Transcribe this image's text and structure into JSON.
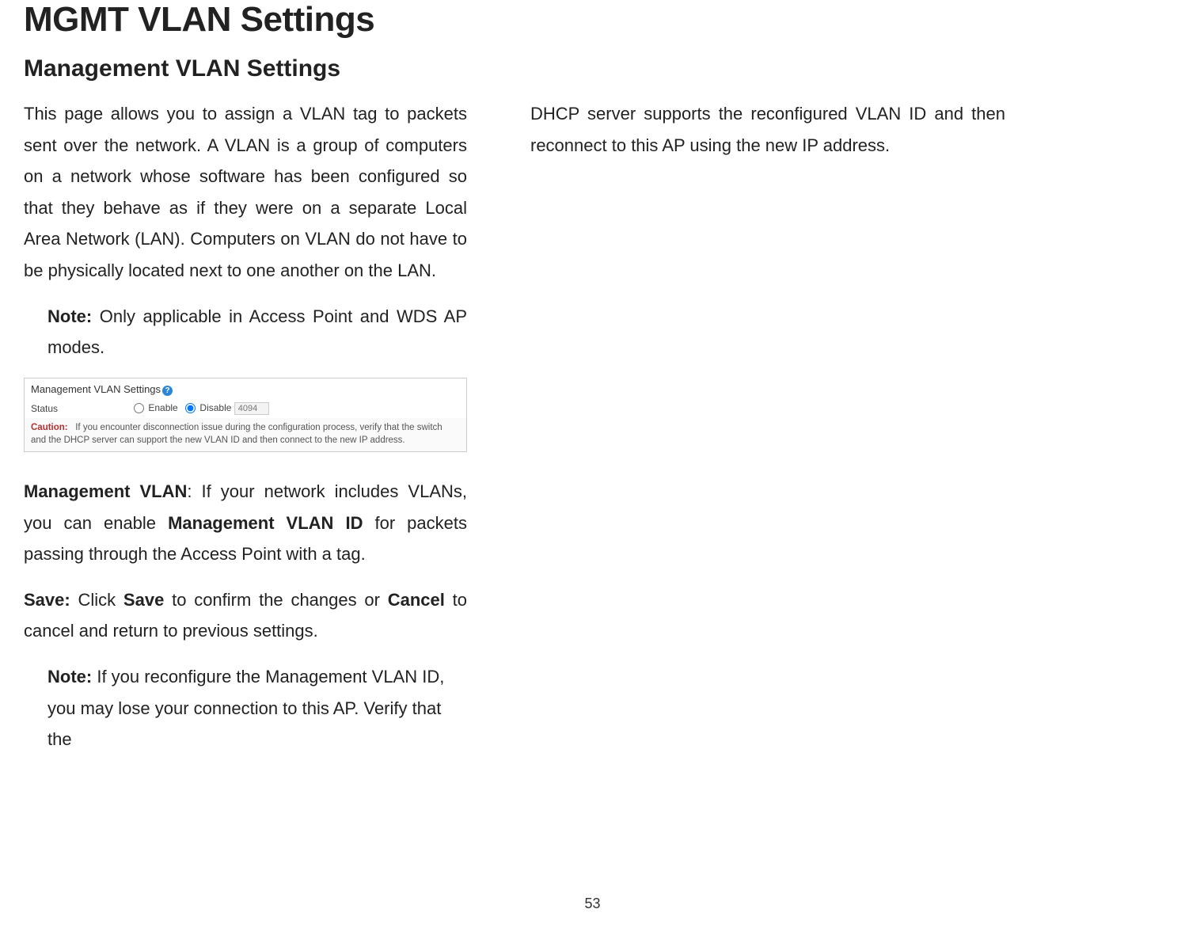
{
  "heading": "MGMT VLAN Settings",
  "subheading": "Management VLAN Settings",
  "left": {
    "intro": "This page allows you to assign a VLAN tag to packets sent over the network. A VLAN is a group of computers on a network whose software has been configured so that they behave as if they were on a separate Local Area Network (LAN). Computers on VLAN do not have to be physically located next to one another on the LAN.",
    "note1_label": "Note:",
    "note1_text": " Only applicable in Access Point and WDS AP modes.",
    "mgmt_label": "Management VLAN",
    "mgmt_text": ": If your network includes VLANs, you can enable ",
    "mgmt_bold2": "Management VLAN ID",
    "mgmt_text2": " for packets passing through the Access Point with a tag.",
    "save_label": "Save:",
    "save_text": " Click ",
    "save_bold2": "Save",
    "save_text2": " to confirm the changes or ",
    "save_bold3": "Cancel",
    "save_text3": " to cancel and return to previous settings.",
    "note2_label": "Note:",
    "note2_text": " If you reconfigure the Management VLAN ID, you may lose your connection to this AP. Verify that the"
  },
  "right": {
    "text": "DHCP server supports the reconfigured VLAN ID and then reconnect to this AP using the new IP address."
  },
  "panel": {
    "title": "Management VLAN Settings",
    "info_glyph": "?",
    "status_label": "Status",
    "enable_label": "Enable",
    "disable_label": "Disable",
    "vlan_placeholder": "4094",
    "caution_label": "Caution:",
    "caution_text": "If you encounter disconnection issue during the configuration process, verify that the switch and the DHCP server can support the new VLAN ID and then connect to the new IP address."
  },
  "page_number": "53"
}
